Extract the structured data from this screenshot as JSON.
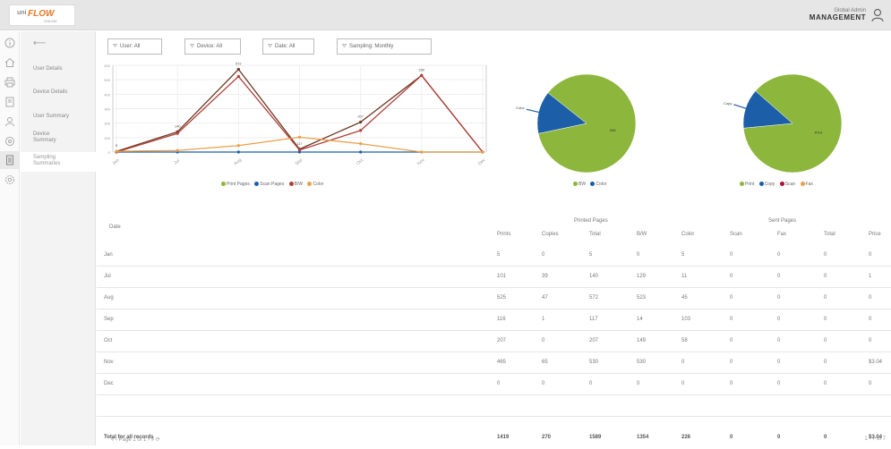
{
  "header": {
    "logo_top": "uni",
    "logo_main": "FLOW",
    "logo_sub": "ONLINE",
    "user_name": "Global Admin",
    "user_role": "MANAGEMENT"
  },
  "icon_rail": [
    "info-icon",
    "home-icon",
    "printer-icon",
    "report-icon",
    "user-icon",
    "device-icon",
    "document-icon",
    "settings-icon"
  ],
  "sidebar": {
    "back_label": "⟵",
    "items": [
      {
        "label": "User Details"
      },
      {
        "label": "Device Details"
      },
      {
        "label": "User Summary"
      },
      {
        "label": "Device Summary"
      },
      {
        "label": "Sampling Summaries"
      }
    ]
  },
  "filters": [
    {
      "label": "User: All"
    },
    {
      "label": "Device: All"
    },
    {
      "label": "Date: All"
    },
    {
      "label": "Sampling: Monthly"
    }
  ],
  "line_legend": [
    "Print Pages",
    "Scan Pages",
    "B/W",
    "Color"
  ],
  "pie1_legend": [
    "BW",
    "Color"
  ],
  "pie2_legend": [
    "Print",
    "Copy",
    "Scan",
    "Fax"
  ],
  "colors": {
    "print": "#6b3a24",
    "scan": "#1f5fa8",
    "bw": "#b0403a",
    "color": "#e8a14a",
    "pie_green": "#8db63c",
    "pie_blue": "#1c5ea8"
  },
  "chart_data": [
    {
      "type": "line",
      "categories": [
        "Jan",
        "Jul",
        "Aug",
        "Sep",
        "Oct",
        "Nov",
        "Dec"
      ],
      "series": [
        {
          "name": "Print Pages",
          "values": [
            5,
            140,
            572,
            20,
            207,
            530,
            0
          ]
        },
        {
          "name": "Scan Pages",
          "values": [
            0,
            0,
            0,
            0,
            0,
            0,
            0
          ]
        },
        {
          "name": "B/W",
          "values": [
            0,
            129,
            523,
            14,
            149,
            530,
            0
          ]
        },
        {
          "name": "Color",
          "values": [
            5,
            11,
            45,
            103,
            58,
            0,
            0
          ]
        }
      ],
      "point_labels": [
        "5",
        "140",
        "572",
        "117",
        "207",
        "530",
        ""
      ],
      "ylim": [
        0,
        600
      ],
      "yticks": [
        0,
        100,
        200,
        300,
        400,
        500,
        600
      ]
    },
    {
      "type": "pie",
      "labels": [
        "BW",
        "Color"
      ],
      "values": [
        86,
        14
      ],
      "slice_labels": [
        "Color",
        "BW"
      ]
    },
    {
      "type": "pie",
      "labels": [
        "Print",
        "Copy",
        "Scan",
        "Fax"
      ],
      "values": [
        87,
        13,
        0,
        0
      ],
      "slice_labels": [
        "Copy",
        "Print"
      ]
    }
  ],
  "table": {
    "date_header": "Date",
    "printed_group": "Printed Pages",
    "sent_group": "Sent Pages",
    "columns": [
      "Prints",
      "Copies",
      "Total",
      "B/W",
      "Color",
      "Scan",
      "Fax",
      "Total",
      "Price"
    ],
    "rows": [
      {
        "date": "Jan",
        "cells": [
          "5",
          "0",
          "5",
          "0",
          "5",
          "0",
          "0",
          "0",
          "0"
        ]
      },
      {
        "date": "Jul",
        "cells": [
          "101",
          "39",
          "140",
          "129",
          "11",
          "0",
          "0",
          "0",
          "1"
        ]
      },
      {
        "date": "Aug",
        "cells": [
          "525",
          "47",
          "572",
          "523",
          "45",
          "0",
          "0",
          "0",
          "0"
        ]
      },
      {
        "date": "Sep",
        "cells": [
          "116",
          "1",
          "117",
          "14",
          "103",
          "0",
          "0",
          "0",
          "0"
        ]
      },
      {
        "date": "Oct",
        "cells": [
          "207",
          "0",
          "207",
          "149",
          "58",
          "0",
          "0",
          "0",
          "0"
        ]
      },
      {
        "date": "Nov",
        "cells": [
          "465",
          "65",
          "530",
          "530",
          "0",
          "0",
          "0",
          "0",
          "$3.04"
        ]
      },
      {
        "date": "Dec",
        "cells": [
          "0",
          "0",
          "0",
          "0",
          "0",
          "0",
          "0",
          "0",
          "0"
        ]
      }
    ],
    "total_label": "Total for all records",
    "total_cells": [
      "1419",
      "270",
      "1589",
      "1354",
      "226",
      "0",
      "0",
      "0",
      "$3.04"
    ]
  },
  "pager": {
    "text": "« ‹  Page 1  of 1  › »  ⟳",
    "info": "1 - 7 of 7"
  }
}
